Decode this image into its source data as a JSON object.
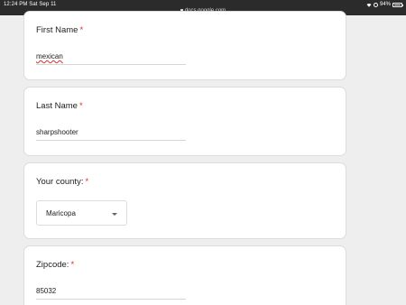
{
  "status_bar": {
    "time": "12:24 PM  Sat Sep 11",
    "url": "docs.google.com",
    "battery": "94%",
    "battery_level": 0.94
  },
  "form": {
    "required_marker": "*",
    "questions": [
      {
        "title": "First Name",
        "answer": "mexican"
      },
      {
        "title": "Last Name",
        "answer": "sharpshooter"
      },
      {
        "title": "Your county:",
        "answer": "Maricopa"
      },
      {
        "title": "Zipcode:",
        "answer": "85032"
      }
    ]
  },
  "colors": {
    "required": "#d93025",
    "page_background": "#eeeeee",
    "status_bar": "#2b2b2b"
  },
  "icons": [
    "lock-icon",
    "wifi-icon",
    "orientation-lock-icon",
    "battery-icon",
    "dropdown-caret-icon"
  ]
}
